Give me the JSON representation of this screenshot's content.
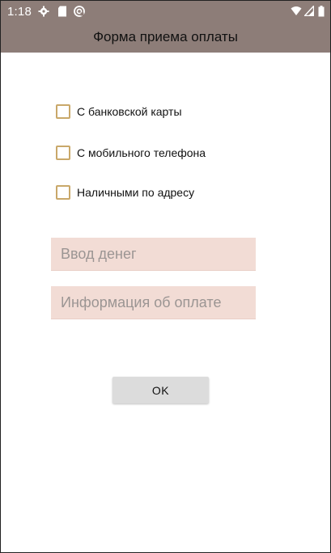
{
  "status_bar": {
    "time": "1:18",
    "icons_left": [
      "gear-icon",
      "sd-card-icon",
      "sync-icon"
    ],
    "icons_right": [
      "wifi-icon",
      "signal-icon",
      "battery-icon"
    ]
  },
  "app_bar": {
    "title": "Форма приема оплаты",
    "color": "#8d7d78"
  },
  "options": [
    {
      "label": "С банковской карты",
      "checked": false
    },
    {
      "label": "С мобильного телефона",
      "checked": false
    },
    {
      "label": "Наличными по адресу",
      "checked": false
    }
  ],
  "inputs": [
    {
      "placeholder": "Ввод денег",
      "value": ""
    },
    {
      "placeholder": "Информация об оплате",
      "value": ""
    }
  ],
  "ok_button": {
    "label": "OK"
  },
  "colors": {
    "checkbox_border": "#c9a86a",
    "field_background": "#f2dcd5",
    "button_background": "#dcdcdc"
  }
}
